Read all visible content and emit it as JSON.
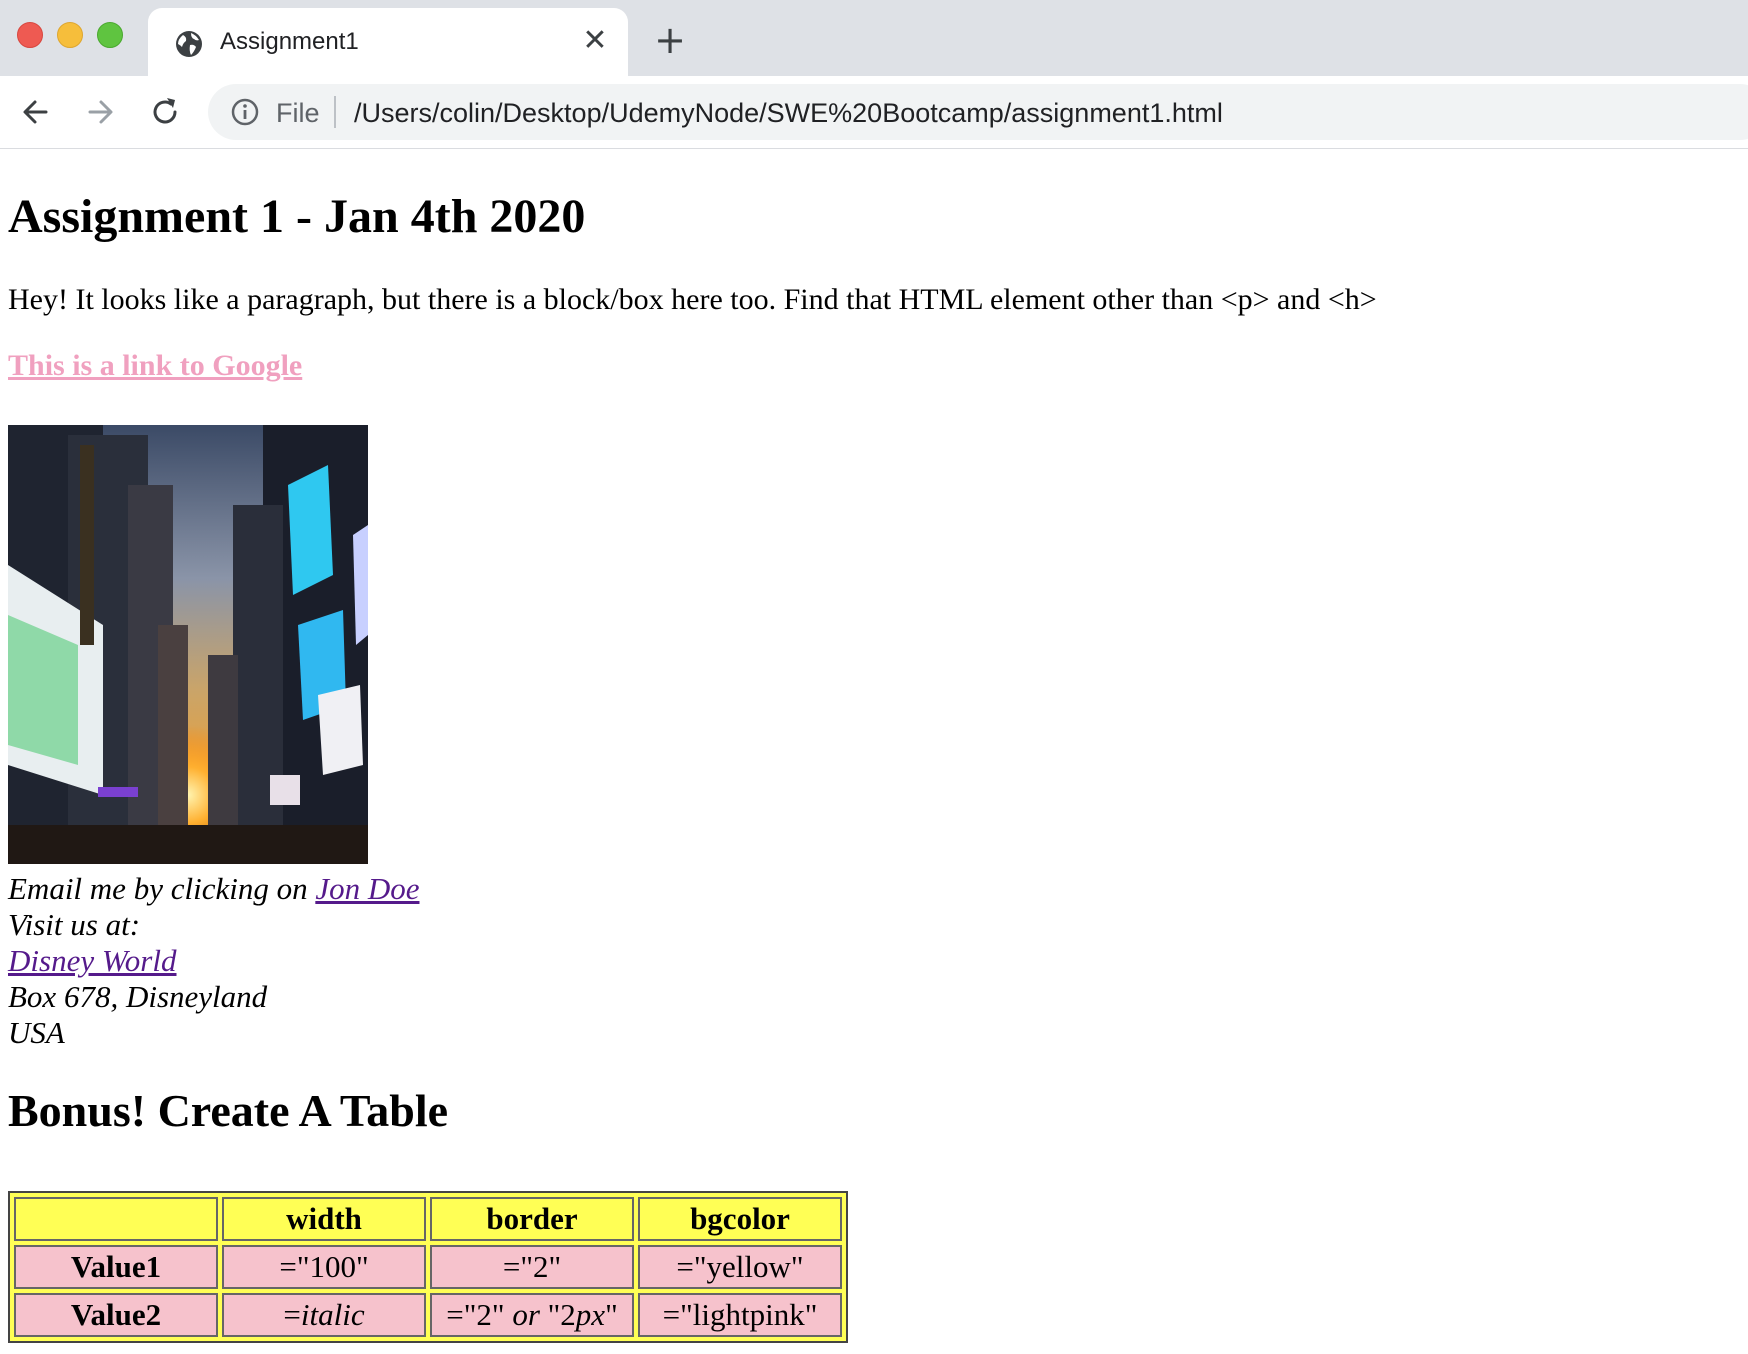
{
  "browser": {
    "tab_title": "Assignment1",
    "url_scheme": "File",
    "url": "/Users/colin/Desktop/UdemyNode/SWE%20Bootcamp/assignment1.html"
  },
  "page": {
    "heading": "Assignment 1 - Jan 4th 2020",
    "paragraph": "Hey! It looks like a paragraph, but there is a block/box here too. Find that HTML element other than <p> and <h>",
    "google_link": "This is a link to Google",
    "address": {
      "email_prefix": "Email me by clicking on ",
      "email_link": "Jon Doe",
      "visit": "Visit us at:",
      "site_link": "Disney World",
      "line1": "Box 678, Disneyland",
      "line2": "USA"
    },
    "bonus_heading": "Bonus! Create A Table",
    "table": {
      "headers": [
        "",
        "width",
        "border",
        "bgcolor"
      ],
      "row1": {
        "label": "Value1",
        "width": "=\"100\"",
        "border": "=\"2\"",
        "bgcolor": "=\"yellow\""
      },
      "row2": {
        "label": "Value2",
        "width_eq": "=",
        "width_italic": "italic",
        "border_a": "=\"2\" ",
        "border_or": "or",
        "border_b": " \"2",
        "border_px": "px",
        "border_end": "\"",
        "bgcolor": "=\"lightpink\""
      }
    }
  },
  "colors": {
    "link_pink": "#f0a0bf",
    "visited_link": "#551a8b",
    "table_yellow": "#ffff55",
    "table_pink": "#f6c2cc"
  }
}
